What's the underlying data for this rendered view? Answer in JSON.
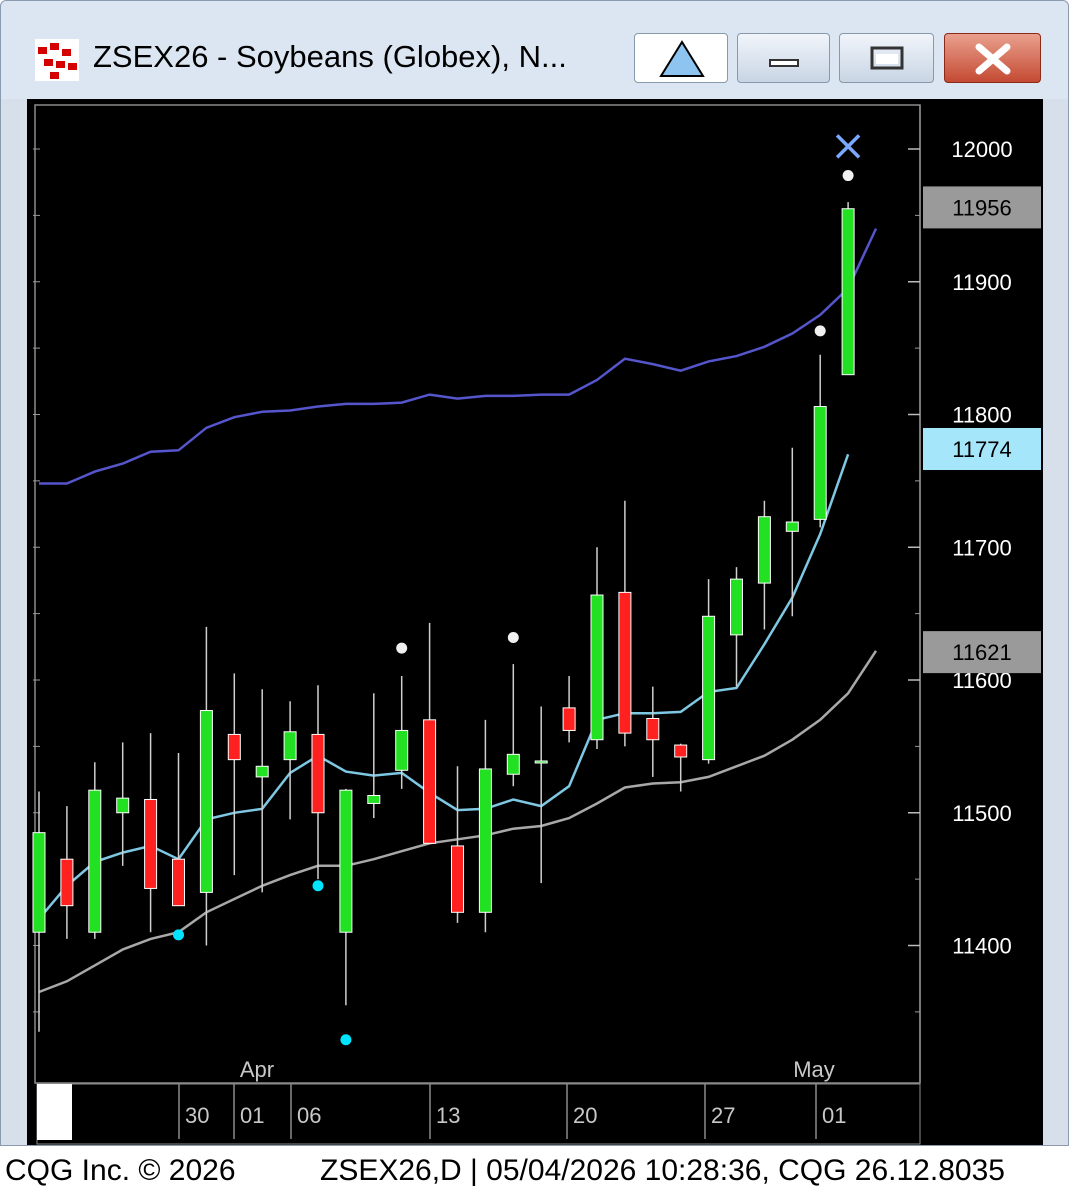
{
  "window": {
    "title": "ZSEX26 - Soybeans (Globex), N...",
    "buttons": [
      "up-triangle",
      "minimize",
      "maximize",
      "close"
    ]
  },
  "footer": {
    "copyright": "CQG Inc. © 2026",
    "status": "ZSEX26,D | 05/04/2026 10:28:36, CQG 26.12.8035"
  },
  "colors": {
    "background": "#000000",
    "up_candle": "#22e022",
    "down_candle": "#ff2020",
    "ma_fast": "#7ec8e3",
    "ma_slow": "#a8a8a8",
    "upper_band": "#5555cc",
    "price_tag_current": "#a6e6fb",
    "price_tag_other": "#9a9a9a"
  },
  "chart_data": {
    "type": "candlestick",
    "ylim": [
      11320,
      12050
    ],
    "y_ticks": [
      "12000",
      "11900",
      "11800",
      "11700",
      "11600",
      "11500",
      "11400"
    ],
    "month_labels": [
      "Apr",
      "May"
    ],
    "date_labels": [
      "30",
      "01",
      "06",
      "13",
      "20",
      "27",
      "01"
    ],
    "price_tags": [
      {
        "label": "11956",
        "value": 11956,
        "style": "other"
      },
      {
        "label": "11774",
        "value": 11774,
        "style": "current"
      },
      {
        "label": "11621",
        "value": 11621,
        "style": "other"
      }
    ],
    "candles": [
      {
        "o": 11410,
        "h": 11516,
        "l": 11335,
        "c": 11485
      },
      {
        "o": 11465,
        "h": 11505,
        "l": 11405,
        "c": 11430
      },
      {
        "o": 11410,
        "h": 11538,
        "l": 11405,
        "c": 11517
      },
      {
        "o": 11500,
        "h": 11553,
        "l": 11460,
        "c": 11511
      },
      {
        "o": 11510,
        "h": 11560,
        "l": 11410,
        "c": 11443
      },
      {
        "o": 11465,
        "h": 11545,
        "l": 11430,
        "c": 11430
      },
      {
        "o": 11440,
        "h": 11640,
        "l": 11400,
        "c": 11577
      },
      {
        "o": 11559,
        "h": 11605,
        "l": 11453,
        "c": 11540
      },
      {
        "o": 11527,
        "h": 11593,
        "l": 11440,
        "c": 11535
      },
      {
        "o": 11540,
        "h": 11584,
        "l": 11495,
        "c": 11561
      },
      {
        "o": 11559,
        "h": 11596,
        "l": 11450,
        "c": 11500
      },
      {
        "o": 11410,
        "h": 11518,
        "l": 11355,
        "c": 11517
      },
      {
        "o": 11507,
        "h": 11590,
        "l": 11496,
        "c": 11513
      },
      {
        "o": 11532,
        "h": 11603,
        "l": 11518,
        "c": 11562
      },
      {
        "o": 11570,
        "h": 11643,
        "l": 11478,
        "c": 11477
      },
      {
        "o": 11475,
        "h": 11535,
        "l": 11417,
        "c": 11425
      },
      {
        "o": 11425,
        "h": 11570,
        "l": 11410,
        "c": 11533
      },
      {
        "o": 11529,
        "h": 11612,
        "l": 11520,
        "c": 11544
      },
      {
        "o": 11539,
        "h": 11580,
        "l": 11447,
        "c": 11539
      },
      {
        "o": 11579,
        "h": 11603,
        "l": 11553,
        "c": 11562
      },
      {
        "o": 11555,
        "h": 11700,
        "l": 11548,
        "c": 11664
      },
      {
        "o": 11666,
        "h": 11735,
        "l": 11550,
        "c": 11560
      },
      {
        "o": 11571,
        "h": 11595,
        "l": 11527,
        "c": 11555
      },
      {
        "o": 11551,
        "h": 11552,
        "l": 11516,
        "c": 11542
      },
      {
        "o": 11540,
        "h": 11676,
        "l": 11537,
        "c": 11648
      },
      {
        "o": 11634,
        "h": 11685,
        "l": 11595,
        "c": 11676
      },
      {
        "o": 11673,
        "h": 11735,
        "l": 11638,
        "c": 11723
      },
      {
        "o": 11712,
        "h": 11775,
        "l": 11648,
        "c": 11719
      },
      {
        "o": 11721,
        "h": 11845,
        "l": 11715,
        "c": 11806
      },
      {
        "o": 11830,
        "h": 11960,
        "l": 11830,
        "c": 11955
      }
    ],
    "series": [
      {
        "values": [
          11420,
          11445,
          11463,
          11470,
          11475,
          11465,
          11495,
          11500,
          11503,
          11530,
          11543,
          11531,
          11528,
          11530,
          11515,
          11502,
          11503,
          11510,
          11505,
          11520,
          11570,
          11575,
          11575,
          11576,
          11591,
          11594,
          11627,
          11662,
          11710,
          11770
        ]
      },
      {
        "values": [
          11365,
          11373,
          11385,
          11397,
          11405,
          11410,
          11425,
          11435,
          11445,
          11453,
          11460,
          11460,
          11465,
          11471,
          11477,
          11480,
          11483,
          11488,
          11490,
          11496,
          11507,
          11519,
          11522,
          11523,
          11527,
          11535,
          11543,
          11555,
          11570,
          11590,
          11622
        ]
      },
      {
        "values": [
          11748,
          11748,
          11757,
          11763,
          11772,
          11773,
          11790,
          11798,
          11802,
          11803,
          11806,
          11808,
          11808,
          11809,
          11815,
          11812,
          11814,
          11814,
          11815,
          11815,
          11826,
          11842,
          11838,
          11833,
          11840,
          11844,
          11851,
          11861,
          11875,
          11895,
          11940
        ]
      }
    ],
    "markers": [
      {
        "type": "dot",
        "color": "#00e5ff",
        "index": 5,
        "value": 11408
      },
      {
        "type": "dot",
        "color": "#00e5ff",
        "index": 10,
        "value": 11445
      },
      {
        "type": "dot",
        "color": "#00e5ff",
        "index": 11,
        "value": 11329
      },
      {
        "type": "dot",
        "color": "#f0f0f0",
        "index": 13,
        "value": 11624
      },
      {
        "type": "dot",
        "color": "#f0f0f0",
        "index": 17,
        "value": 11632
      },
      {
        "type": "dot",
        "color": "#f0f0f0",
        "index": 28,
        "value": 11863
      },
      {
        "type": "dot",
        "color": "#f0f0f0",
        "index": 29,
        "value": 11980
      },
      {
        "type": "cross",
        "color": "#7aa8ff",
        "index": 29,
        "value": 12002
      }
    ]
  }
}
